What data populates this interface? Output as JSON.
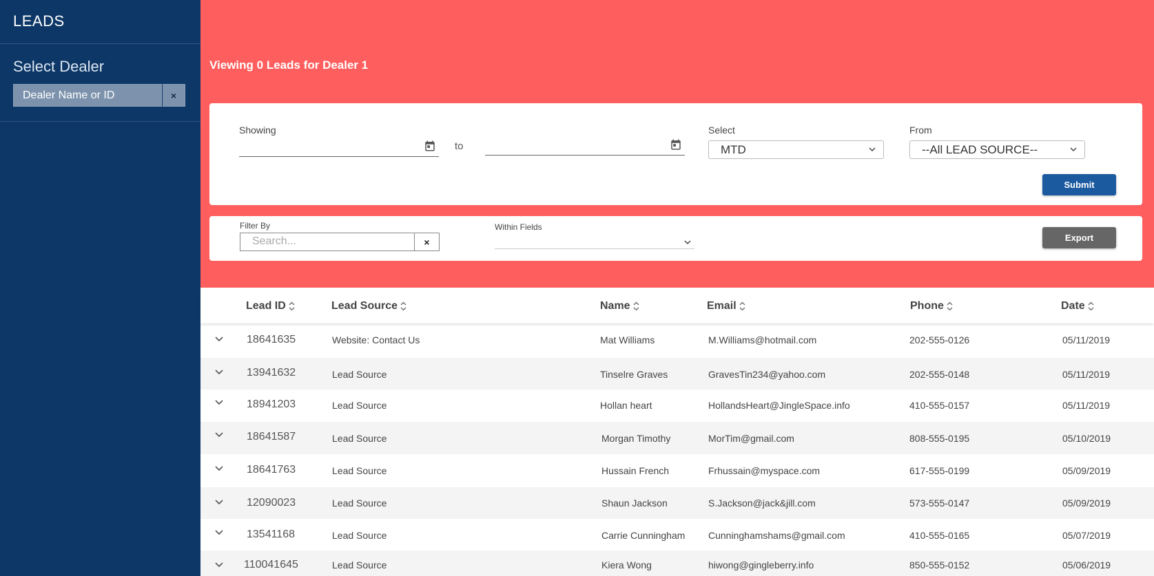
{
  "sidebar": {
    "title": "LEADS",
    "select_dealer_label": "Select Dealer",
    "dealer_input_value": "Dealer Name or ID",
    "clear_icon": "×"
  },
  "header": {
    "viewing_text": "Viewing 0 Leads for Dealer 1"
  },
  "range": {
    "showing_label": "Showing",
    "from_date": "",
    "to_label": "to",
    "to_date": "",
    "select_label": "Select",
    "select_value": "MTD",
    "from_label": "From",
    "from_value": "--All LEAD SOURCE--",
    "submit_label": "Submit"
  },
  "filter": {
    "filter_by_label": "Filter By",
    "search_placeholder": "Search...",
    "clear_icon": "×",
    "within_fields_label": "Within Fields",
    "within_fields_value": "",
    "export_label": "Export"
  },
  "table": {
    "headers": [
      "Lead ID",
      "Lead Source",
      "Name",
      "Email",
      "Phone",
      "Date"
    ],
    "rows": [
      {
        "id": "18641635",
        "source": "Website: Contact Us",
        "name": "Mat Williams",
        "email": "M.Williams@hotmail.com",
        "phone": "202-555-0126",
        "date": "05/11/2019"
      },
      {
        "id": "13941632",
        "source": "Lead Source",
        "name": "Tinselre Graves",
        "email": "GravesTin234@yahoo.com",
        "phone": "202-555-0148",
        "date": "05/11/2019"
      },
      {
        "id": "18941203",
        "source": "Lead Source",
        "name": "Hollan heart",
        "email": "HollandsHeart@JingleSpace.info",
        "phone": "410-555-0157",
        "date": "05/11/2019"
      },
      {
        "id": "18641587",
        "source": "Lead Source",
        "name": "Morgan Timothy",
        "email": "MorTim@gmail.com",
        "phone": "808-555-0195",
        "date": "05/10/2019"
      },
      {
        "id": "18641763",
        "source": "Lead Source",
        "name": "Hussain French",
        "email": "Frhussain@myspace.com",
        "phone": "617-555-0199",
        "date": "05/09/2019"
      },
      {
        "id": "12090023",
        "source": "Lead Source",
        "name": "Shaun Jackson",
        "email": "S.Jackson@jack&jill.com",
        "phone": "573-555-0147",
        "date": "05/09/2019"
      },
      {
        "id": "13541168",
        "source": "Lead Source",
        "name": "Carrie Cunningham",
        "email": "Cunninghamshams@gmail.com",
        "phone": "410-555-0165",
        "date": "05/07/2019"
      },
      {
        "id": "110041645",
        "source": "Lead Source",
        "name": "Kiera Wong",
        "email": "hiwong@gingleberry.info",
        "phone": "850-555-0152",
        "date": "05/06/2019"
      }
    ]
  },
  "colors": {
    "sidebar_bg": "#0d3766",
    "header_bg": "#ff5e5e",
    "submit_bg": "#1c5aa0",
    "export_bg": "#666666"
  }
}
